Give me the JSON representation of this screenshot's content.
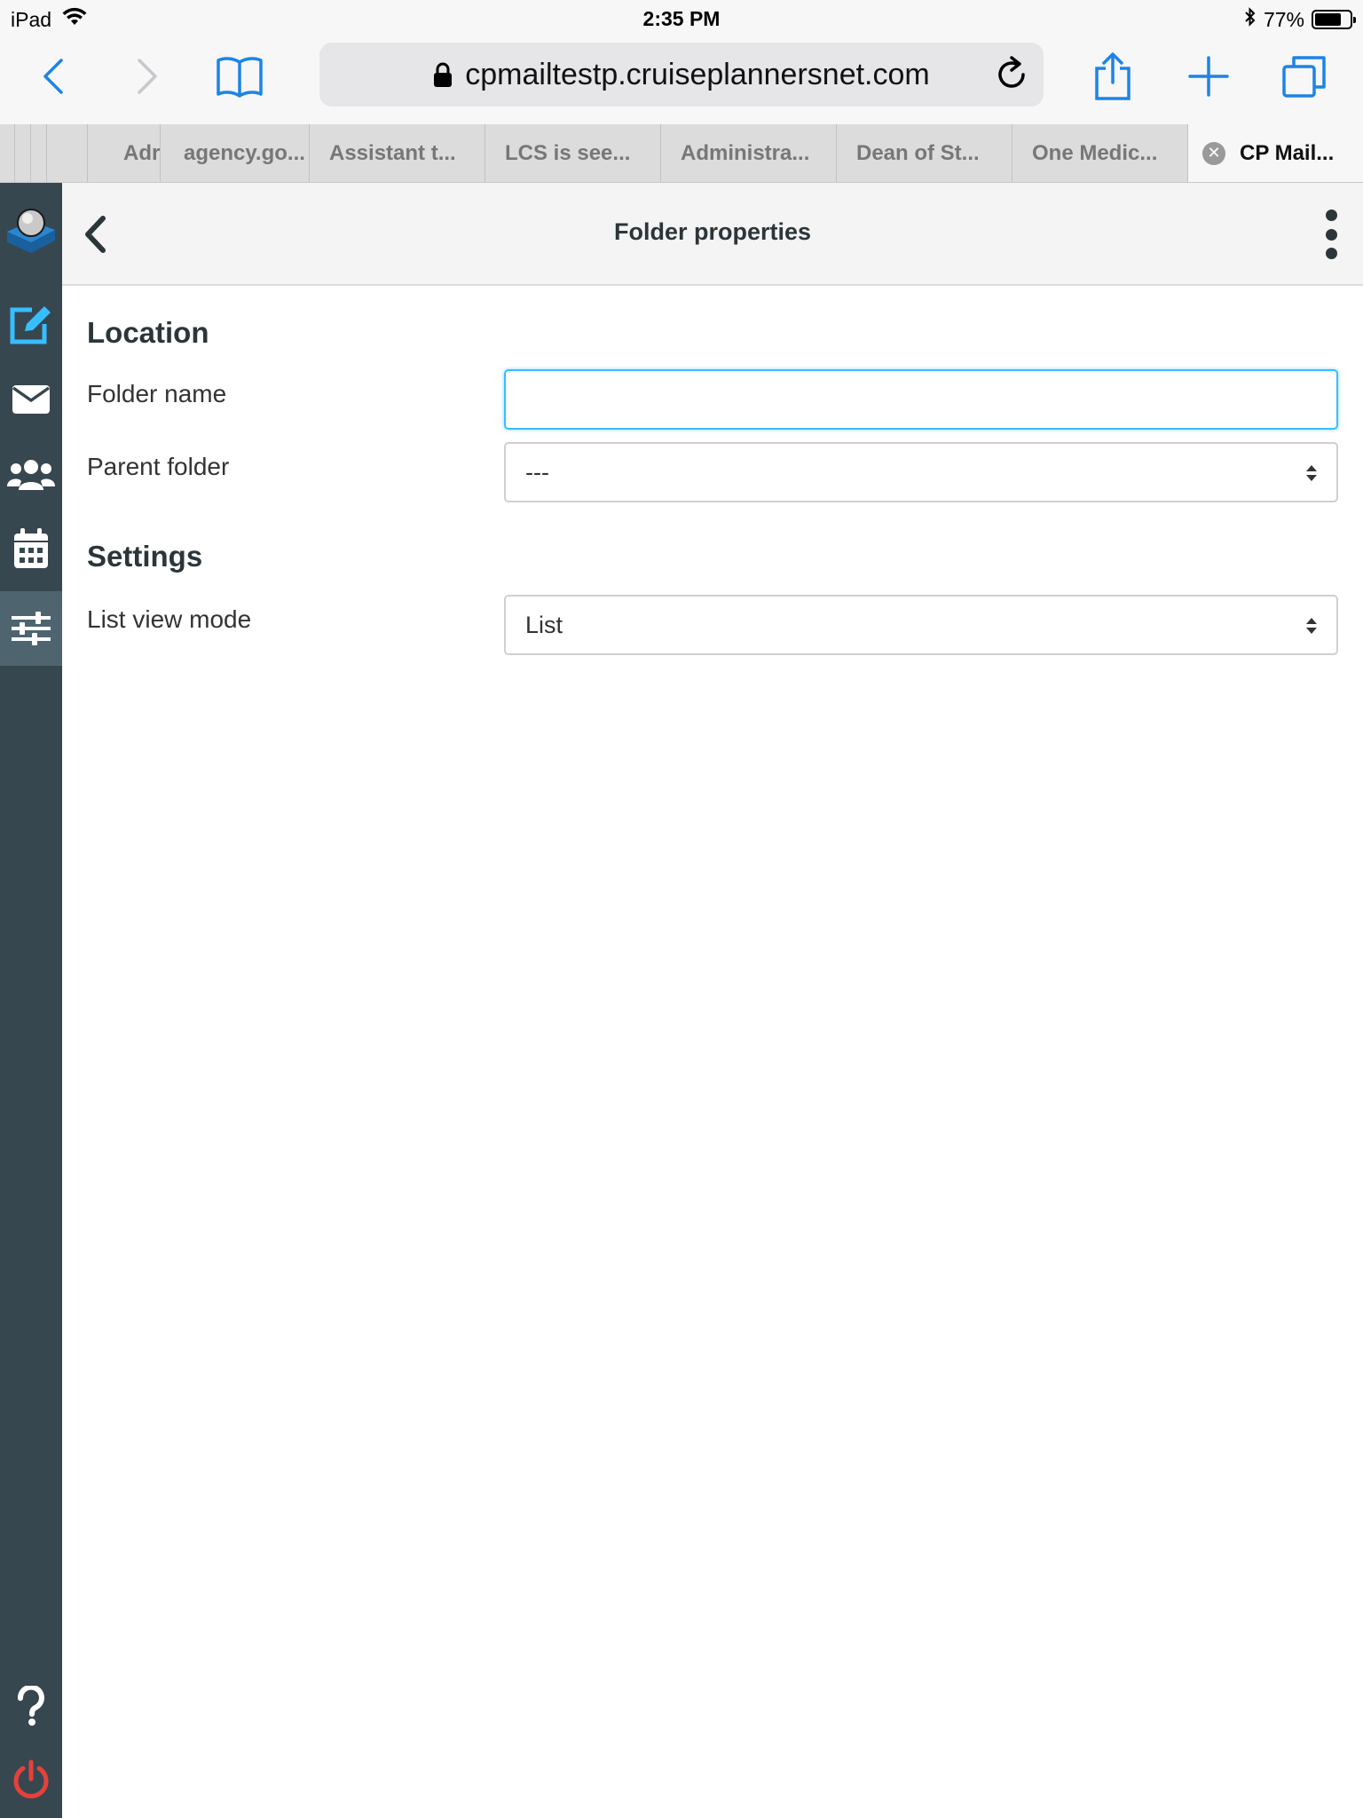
{
  "status_bar": {
    "device": "iPad",
    "time": "2:35 PM",
    "battery_percent": "77%",
    "battery_level": 0.77
  },
  "browser": {
    "url": "cpmailtestp.cruiseplannersnet.com",
    "tabs": [
      {
        "label": "Adr"
      },
      {
        "label": "agency.go..."
      },
      {
        "label": "Assistant t..."
      },
      {
        "label": "LCS is see..."
      },
      {
        "label": "Administra..."
      },
      {
        "label": "Dean of St..."
      },
      {
        "label": "One Medic..."
      },
      {
        "label": "CP Mail..."
      }
    ]
  },
  "sidebar": {
    "items": [
      {
        "name": "logo",
        "icon": "roundcube-logo-icon"
      },
      {
        "name": "compose",
        "icon": "compose-icon"
      },
      {
        "name": "mail",
        "icon": "envelope-icon"
      },
      {
        "name": "contacts",
        "icon": "contacts-icon"
      },
      {
        "name": "calendar",
        "icon": "calendar-icon"
      },
      {
        "name": "settings",
        "icon": "settings-sliders-icon",
        "selected": true
      },
      {
        "name": "help",
        "icon": "help-icon"
      },
      {
        "name": "logout",
        "icon": "power-icon"
      }
    ]
  },
  "header": {
    "title": "Folder properties"
  },
  "form": {
    "location_title": "Location",
    "folder_name_label": "Folder name",
    "folder_name_value": "",
    "parent_folder_label": "Parent folder",
    "parent_folder_value": "---",
    "settings_title": "Settings",
    "list_view_mode_label": "List view mode",
    "list_view_mode_value": "List"
  },
  "colors": {
    "sidebar_bg": "#37474f",
    "accent": "#37beff",
    "ios_blue": "#1d84e6",
    "logout_red": "#e5413b"
  }
}
